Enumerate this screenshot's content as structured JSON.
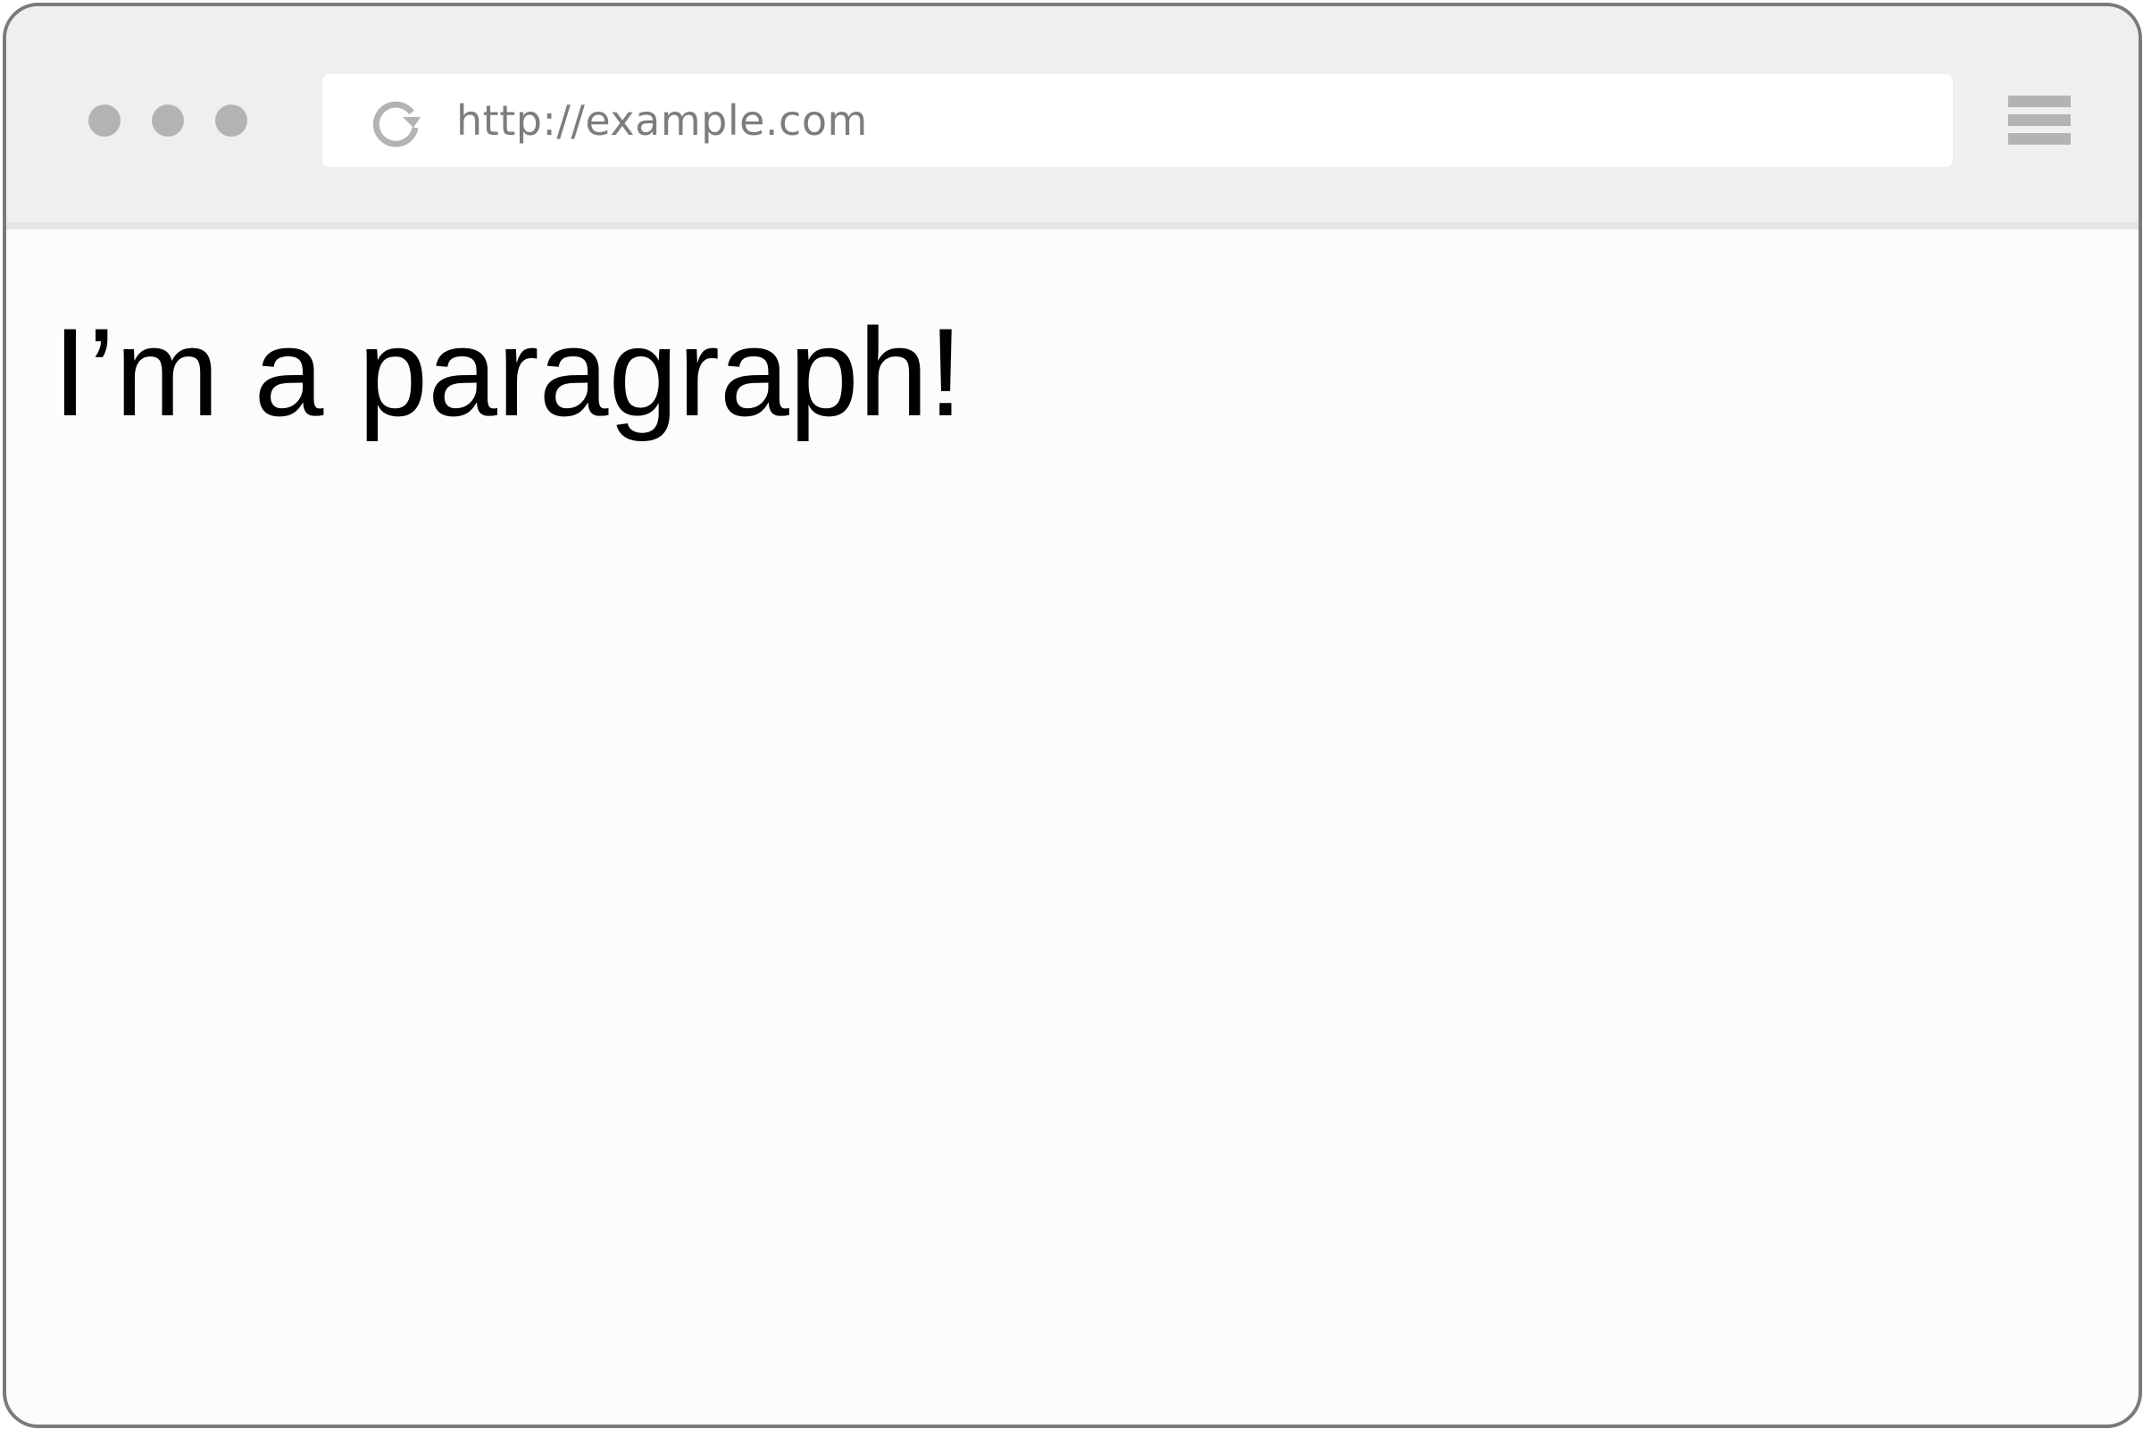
{
  "browser": {
    "address_bar": {
      "url": "http://example.com"
    },
    "icons": {
      "window_controls": [
        "window-dot-icon",
        "window-dot-icon",
        "window-dot-icon"
      ],
      "reload": "reload-icon",
      "menu": "hamburger-menu-icon"
    },
    "colors": {
      "frame_border": "#7a7a7a",
      "toolbar_bg": "#efefef",
      "dots": "#b3b3b3",
      "url_text": "#7d7d7d",
      "page_bg": "#fcfcfc"
    }
  },
  "page": {
    "paragraph": "I’m a paragraph!"
  }
}
